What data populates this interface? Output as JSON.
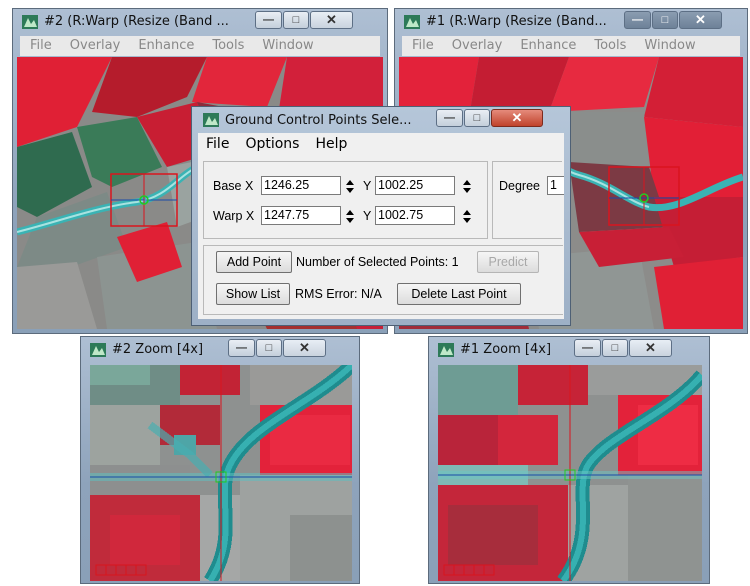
{
  "colors": {
    "vegetation_red": "#e02035",
    "water_cyan": "#3fb7b7",
    "field_grey": "#8e9190",
    "crosshair_red": "#d9141e",
    "crosshair_blue": "#1a4ba8",
    "window_frame": "#9db0c6"
  },
  "window_main2": {
    "title": "#2 (R:Warp (Resize (Band ...",
    "menu": [
      "File",
      "Overlay",
      "Enhance",
      "Tools",
      "Window"
    ],
    "icon": "app-icon"
  },
  "window_main1": {
    "title": "#1 (R:Warp (Resize (Band...",
    "menu": [
      "File",
      "Overlay",
      "Enhance",
      "Tools",
      "Window"
    ],
    "icon": "app-icon"
  },
  "window_zoom2": {
    "title": "#2 Zoom [4x]",
    "icon": "app-icon"
  },
  "window_zoom1": {
    "title": "#1 Zoom [4x]",
    "icon": "app-icon"
  },
  "gcp_dialog": {
    "title": "Ground Control Points Sele...",
    "menu": [
      "File",
      "Options",
      "Help"
    ],
    "base_label": "Base X",
    "base_x": "1246.25",
    "base_y_label": "Y",
    "base_y": "1002.25",
    "warp_label": "Warp X",
    "warp_x": "1247.75",
    "warp_y_label": "Y",
    "warp_y": "1002.75",
    "degree_label": "Degree",
    "degree_value": "1",
    "add_point": "Add Point",
    "selected_points_text": "Number of Selected Points: 1",
    "predict": "Predict",
    "show_list": "Show List",
    "rms_text": "RMS Error: N/A",
    "delete_last": "Delete Last Point"
  },
  "window_controls": {
    "minimize": "—",
    "maximize": "□",
    "close": "✕"
  }
}
